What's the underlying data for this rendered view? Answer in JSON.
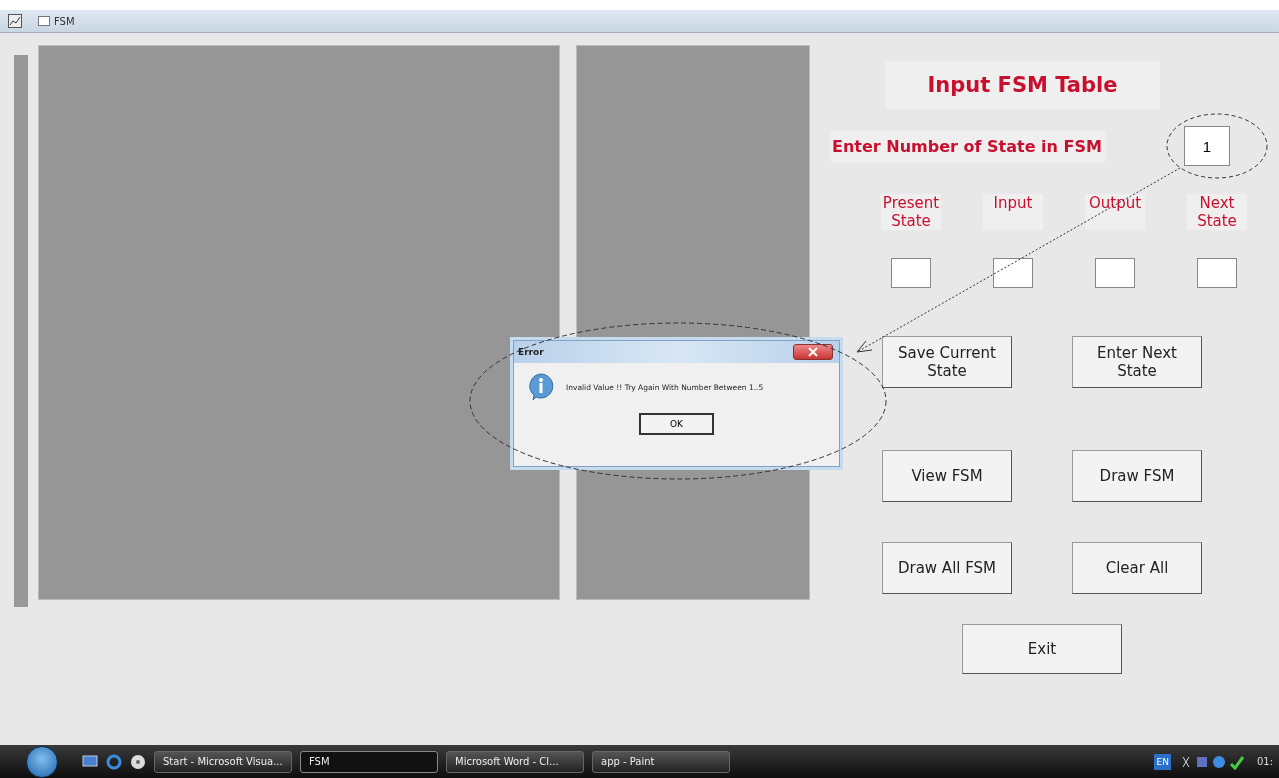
{
  "window": {
    "title": "FSM"
  },
  "form": {
    "heading": "Input FSM Table",
    "state_count_label": "Enter Number of State in FSM",
    "state_count_value": "1",
    "columns": [
      {
        "label": "Present State"
      },
      {
        "label": "Input"
      },
      {
        "label": "Output"
      },
      {
        "label": "Next State"
      }
    ],
    "buttons": [
      [
        "Save Current State",
        "Enter Next State"
      ],
      [
        "View FSM",
        "Draw FSM"
      ],
      [
        "Draw All FSM",
        "Clear All"
      ],
      [
        "Exit"
      ]
    ]
  },
  "dialog": {
    "title": "Error",
    "message": "Invalid Value !! Try Again With Number Between 1..5",
    "button": "OK"
  },
  "taskbar": {
    "items": [
      {
        "label": "Start - Microsoft Visua...",
        "selected": false
      },
      {
        "label": "FSM",
        "selected": true
      },
      {
        "label": "Microsoft Word - Cl...",
        "selected": false
      },
      {
        "label": "app - Paint",
        "selected": false
      }
    ],
    "language": "EN",
    "clock": "01:"
  }
}
